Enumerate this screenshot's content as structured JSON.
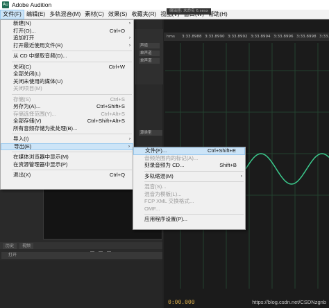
{
  "window": {
    "title": "Adobe Audition",
    "icon": "Au"
  },
  "menubar": [
    {
      "label": "文件(F)",
      "active": true
    },
    {
      "label": "编辑(E)"
    },
    {
      "label": "多轨混音(M)"
    },
    {
      "label": "素材(C)"
    },
    {
      "label": "效果(S)"
    },
    {
      "label": "收藏夹(R)"
    },
    {
      "label": "视图(V)"
    },
    {
      "label": "窗口(W)"
    },
    {
      "label": "帮助(H)"
    }
  ],
  "file_menu": [
    {
      "label": "新建(N)",
      "submenu": true
    },
    {
      "label": "打开(O)...",
      "shortcut": "Ctrl+O"
    },
    {
      "label": "追加打开",
      "submenu": true
    },
    {
      "label": "打开最近使用文件(R)",
      "submenu": true
    },
    {
      "sep": true
    },
    {
      "label": "从 CD 中提取音频(D)..."
    },
    {
      "sep": true
    },
    {
      "label": "关闭(C)",
      "shortcut": "Ctrl+W"
    },
    {
      "label": "全部关闭(L)"
    },
    {
      "label": "关闭未使用的媒体(U)"
    },
    {
      "label": "关闭项目(M)",
      "disabled": true
    },
    {
      "sep": true
    },
    {
      "label": "存储(S)",
      "shortcut": "Ctrl+S",
      "disabled": true
    },
    {
      "label": "另存为(A)...",
      "shortcut": "Ctrl+Shift+S"
    },
    {
      "label": "存储选择范围(Y)...",
      "shortcut": "Ctrl+Alt+S",
      "disabled": true
    },
    {
      "label": "全部存储(V)",
      "shortcut": "Ctrl+Shift+Alt+S"
    },
    {
      "label": "所有音频存储为批处理(B)..."
    },
    {
      "sep": true
    },
    {
      "label": "导入(I)",
      "submenu": true
    },
    {
      "label": "导出(E)",
      "submenu": true,
      "highlighted": true
    },
    {
      "sep": true
    },
    {
      "label": "在媒体浏览器中显示(M)"
    },
    {
      "label": "在资源管理器中显示(P)"
    },
    {
      "sep": true
    },
    {
      "label": "退出(X)",
      "shortcut": "Ctrl+Q"
    }
  ],
  "export_menu": [
    {
      "label": "文件(F)...",
      "shortcut": "Ctrl+Shift+E",
      "highlighted": true
    },
    {
      "label": "音频范围内的标记(A)...",
      "disabled": true
    },
    {
      "label": "刻录音频为 CD...",
      "shortcut": "Shift+B"
    },
    {
      "sep": true
    },
    {
      "label": "多轨缩混(M)",
      "submenu": true
    },
    {
      "sep": true
    },
    {
      "label": "混音(S)...",
      "disabled": true
    },
    {
      "label": "混音为模板(L)...",
      "disabled": true
    },
    {
      "label": "FCP XML 交换格式...",
      "disabled": true
    },
    {
      "label": "OMF...",
      "disabled": true
    },
    {
      "sep": true
    },
    {
      "label": "应用程序设置(P)..."
    }
  ],
  "editor": {
    "tab_label": "编辑器: 未命名 6.sesx",
    "ruler_unit": "hms",
    "ruler_ticks": [
      "3:33.8988",
      "3:33.8990",
      "3:33.8992",
      "3:33.8994",
      "3:33.8996",
      "3:33.8998",
      "3:33.9000"
    ],
    "timecode": "0:00.000",
    "waveform_color": "#3ccb8e"
  },
  "panels": {
    "history_tabs": [
      "历史",
      "视频"
    ],
    "history_item": "打开",
    "track_labels": [
      "声道",
      "单声道",
      "单声道"
    ],
    "strip_label": "源类型"
  },
  "watermark": "https://blog.csdn.net/CSDNzgnb"
}
